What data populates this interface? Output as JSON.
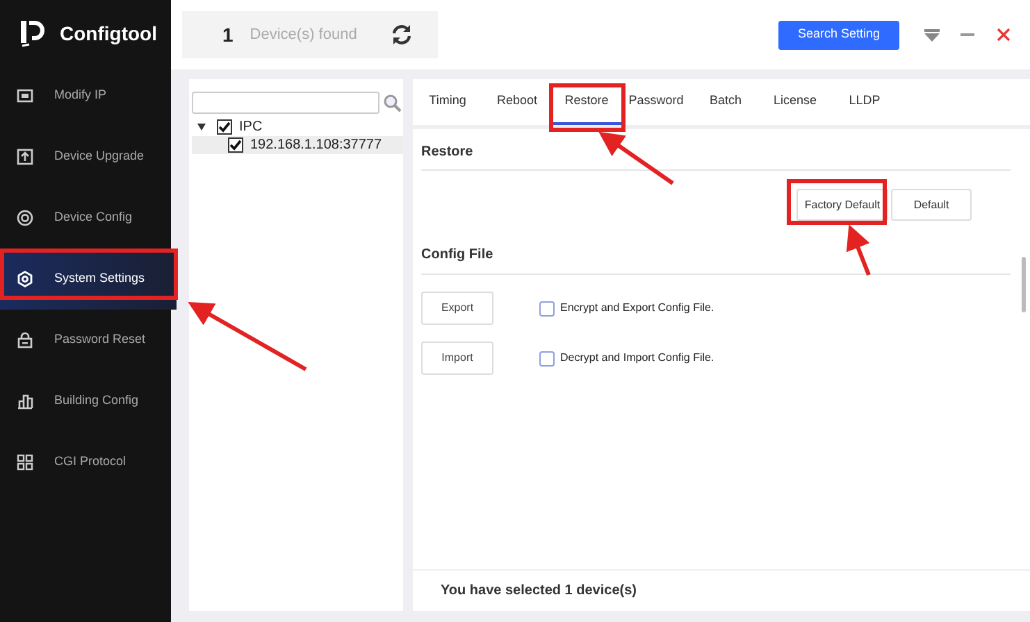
{
  "app": {
    "title": "Configtool"
  },
  "sidebar": {
    "items": [
      {
        "label": "Modify IP",
        "selected": false
      },
      {
        "label": "Device Upgrade",
        "selected": false
      },
      {
        "label": "Device Config",
        "selected": false
      },
      {
        "label": "System Settings",
        "selected": true
      },
      {
        "label": "Password Reset",
        "selected": false
      },
      {
        "label": "Building Config",
        "selected": false
      },
      {
        "label": "CGI Protocol",
        "selected": false
      }
    ]
  },
  "header": {
    "device_count": "1",
    "device_label": "Device(s) found",
    "search_button": "Search Setting"
  },
  "tree": {
    "nodes": [
      {
        "label": "IPC",
        "checked": true,
        "expanded": true,
        "children": [
          {
            "label": "192.168.1.108:37777",
            "checked": true,
            "selected": true
          }
        ]
      }
    ]
  },
  "tabs": [
    {
      "label": "Timing",
      "selected": false
    },
    {
      "label": "Reboot",
      "selected": false
    },
    {
      "label": "Restore",
      "selected": true
    },
    {
      "label": "Password",
      "selected": false
    },
    {
      "label": "Batch",
      "selected": false
    },
    {
      "label": "License",
      "selected": false
    },
    {
      "label": "LLDP",
      "selected": false
    }
  ],
  "restore": {
    "title": "Restore",
    "buttons": [
      "Factory Default",
      "Default"
    ]
  },
  "config_file": {
    "title": "Config File",
    "rows": [
      {
        "button": "Export",
        "option": "Encrypt and Export Config File.",
        "checked": false
      },
      {
        "button": "Import",
        "option": "Decrypt and Import Config File.",
        "checked": false
      }
    ]
  },
  "footer": {
    "text": "You have selected 1 device(s)"
  }
}
